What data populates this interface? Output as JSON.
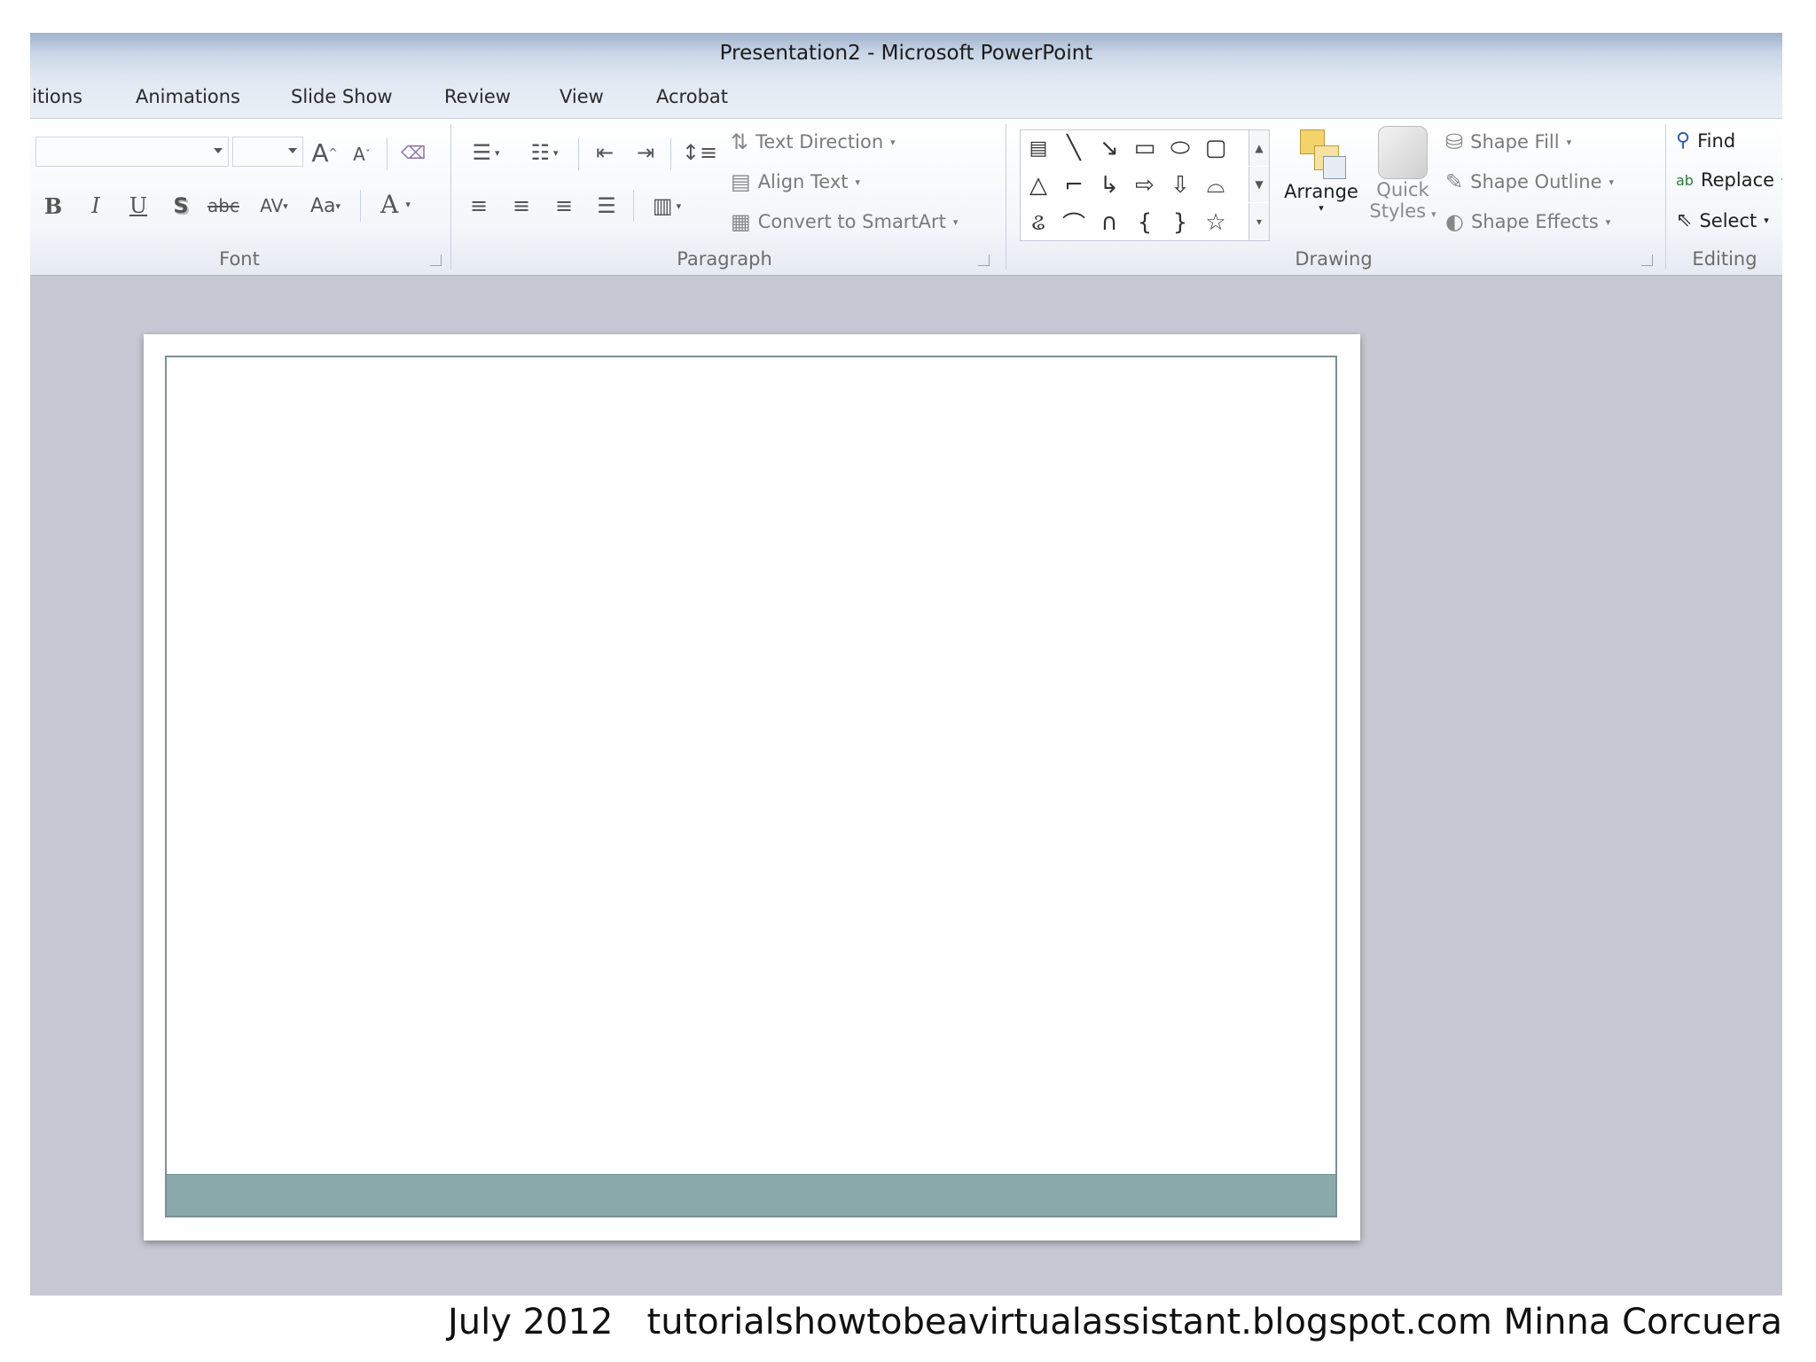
{
  "window": {
    "title": "Presentation2  -  Microsoft PowerPoint"
  },
  "tabs": [
    {
      "label": "itions"
    },
    {
      "label": "Animations"
    },
    {
      "label": "Slide Show"
    },
    {
      "label": "Review"
    },
    {
      "label": "View"
    },
    {
      "label": "Acrobat"
    }
  ],
  "font_group": {
    "label": "Font",
    "font_name": "",
    "font_size": "",
    "grow_label": "A",
    "shrink_label": "A",
    "bold_label": "B",
    "italic_label": "I",
    "underline_label": "U",
    "shadow_label": "S",
    "strike_label": "abc",
    "spacing_label": "AV",
    "case_label": "Aa",
    "color_label": "A"
  },
  "paragraph_group": {
    "label": "Paragraph",
    "text_direction": "Text Direction",
    "align_text": "Align Text",
    "convert_smartart": "Convert to SmartArt"
  },
  "drawing_group": {
    "label": "Drawing",
    "arrange_label": "Arrange",
    "quick_styles_line1": "Quick",
    "quick_styles_line2": "Styles",
    "shape_fill": "Shape Fill",
    "shape_outline": "Shape Outline",
    "shape_effects": "Shape Effects"
  },
  "editing_group": {
    "label": "Editing",
    "find": "Find",
    "replace": "Replace",
    "select": "Select"
  },
  "colors": {
    "slide_band": "#8aa9aa",
    "workspace": "#c6c9d3"
  },
  "caption": "July 2012   tutorialshowtobeavirtualassistant.blogspot.com Minna Corcuera"
}
